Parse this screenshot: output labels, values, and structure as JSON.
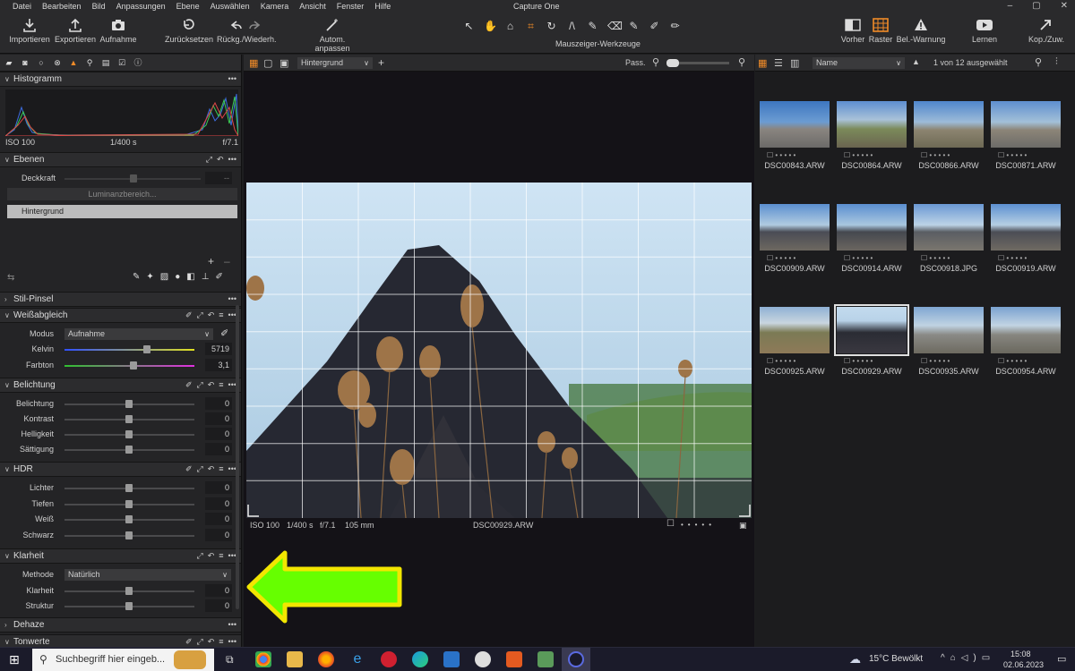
{
  "app": {
    "title": "Capture One"
  },
  "menu": [
    "Datei",
    "Bearbeiten",
    "Bild",
    "Anpassungen",
    "Ebene",
    "Auswählen",
    "Kamera",
    "Ansicht",
    "Fenster",
    "Hilfe"
  ],
  "toolbar": {
    "import": "Importieren",
    "export": "Exportieren",
    "capture": "Aufnahme",
    "reset": "Zurücksetzen",
    "undo_redo": "Rückg./Wiederh.",
    "auto_adjust": "Autom. anpassen",
    "cursor_tools": "Mauszeiger-Werkzeuge",
    "before": "Vorher",
    "grid": "Raster",
    "exposure_warning": "Bel.-Warnung",
    "learn": "Lernen",
    "copy_apply": "Kop./Zuw."
  },
  "histogram": {
    "title": "Histogramm",
    "iso": "ISO 100",
    "shutter": "1/400 s",
    "aperture": "f/7.1"
  },
  "layers": {
    "title": "Ebenen",
    "opacity_label": "Deckkraft",
    "opacity_value": "--",
    "luma_range": "Luminanzbereich...",
    "layer_name": "Hintergrund"
  },
  "style_brush": {
    "title": "Stil-Pinsel"
  },
  "white_balance": {
    "title": "Weißabgleich",
    "mode_label": "Modus",
    "mode_value": "Aufnahme",
    "kelvin_label": "Kelvin",
    "kelvin_value": "5719",
    "tint_label": "Farbton",
    "tint_value": "3,1"
  },
  "exposure": {
    "title": "Belichtung",
    "rows": [
      {
        "label": "Belichtung",
        "value": "0"
      },
      {
        "label": "Kontrast",
        "value": "0"
      },
      {
        "label": "Helligkeit",
        "value": "0"
      },
      {
        "label": "Sättigung",
        "value": "0"
      }
    ]
  },
  "hdr": {
    "title": "HDR",
    "rows": [
      {
        "label": "Lichter",
        "value": "0"
      },
      {
        "label": "Tiefen",
        "value": "0"
      },
      {
        "label": "Weiß",
        "value": "0"
      },
      {
        "label": "Schwarz",
        "value": "0"
      }
    ]
  },
  "clarity": {
    "title": "Klarheit",
    "method_label": "Methode",
    "method_value": "Natürlich",
    "rows": [
      {
        "label": "Klarheit",
        "value": "0"
      },
      {
        "label": "Struktur",
        "value": "0"
      }
    ]
  },
  "dehaze": {
    "title": "Dehaze"
  },
  "tone_curve": {
    "title": "Tonwerte"
  },
  "viewer": {
    "layer_select": "Hintergrund",
    "fit": "Pass.",
    "iso": "ISO 100",
    "shutter": "1/400 s",
    "aperture": "f/7.1",
    "focal": "105 mm",
    "filename": "DSC00929.ARW"
  },
  "browser": {
    "sort": "Name",
    "count": "1 von 12 ausgewählt",
    "files": [
      "DSC00843.ARW",
      "DSC00864.ARW",
      "DSC00866.ARW",
      "DSC00871.ARW",
      "DSC00909.ARW",
      "DSC00914.ARW",
      "DSC00918.JPG",
      "DSC00919.ARW",
      "DSC00925.ARW",
      "DSC00929.ARW",
      "DSC00935.ARW",
      "DSC00954.ARW"
    ]
  },
  "taskbar": {
    "search_placeholder": "Suchbegriff hier eingeb...",
    "weather": "15°C  Bewölkt",
    "time": "15:08",
    "date": "02.06.2023"
  },
  "colors": {
    "accent": "#f08b28",
    "arrow_fill": "#66ff00",
    "arrow_stroke": "#f2e600"
  }
}
